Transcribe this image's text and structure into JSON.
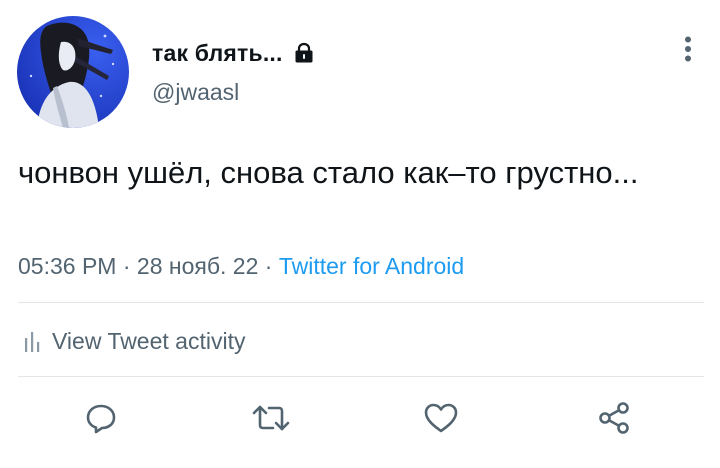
{
  "user": {
    "display_name": "так блять...",
    "handle": "@jwaasl",
    "protected_icon": "lock-icon",
    "avatar_icon": "avatar-image"
  },
  "tweet": {
    "text": "чонвон ушёл, снова стало как–то грустно...",
    "time": "05:36 PM",
    "separator1": " · ",
    "date": "28 нояб. 22",
    "separator2": " · ",
    "source": "Twitter for Android"
  },
  "activity": {
    "label": "View Tweet activity",
    "icon": "bar-chart-icon"
  },
  "actions": {
    "reply_icon": "reply-icon",
    "retweet_icon": "retweet-icon",
    "like_icon": "heart-icon",
    "share_icon": "share-icon"
  },
  "menu": {
    "icon": "more-vertical-icon"
  },
  "colors": {
    "text_primary": "#0f1419",
    "text_secondary": "#536471",
    "accent": "#1d9bf0",
    "divider": "#e2e6e9",
    "avatar_bg": "#1f3fc9"
  }
}
